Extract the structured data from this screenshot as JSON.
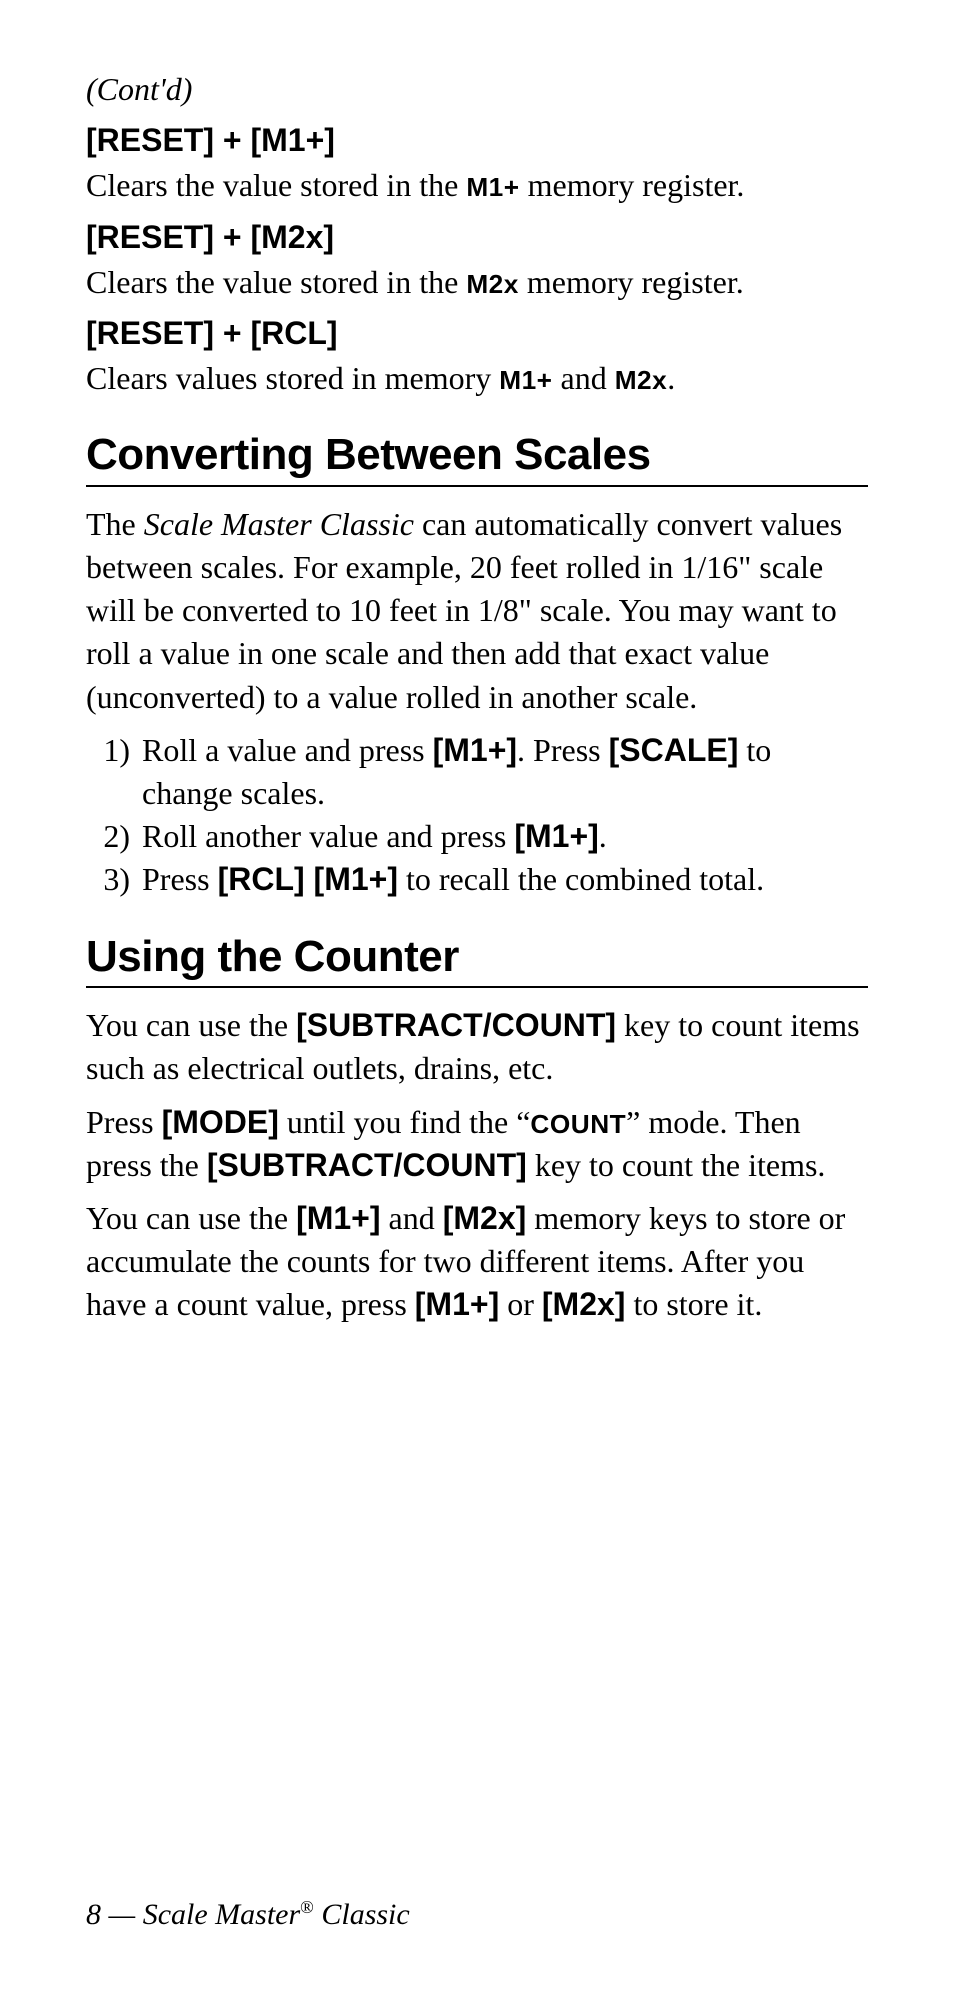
{
  "contd": "(Cont'd)",
  "reset_m1": {
    "label": "[RESET] + [M1+]",
    "desc_a": "Clears the value stored in the ",
    "mem": "M1+",
    "desc_b": " memory register."
  },
  "reset_m2": {
    "label": "[RESET] + [M2x]",
    "desc_a": "Clears the value stored in the ",
    "mem": "M2x",
    "desc_b": " memory register."
  },
  "reset_rcl": {
    "label": "[RESET] + [RCL]",
    "desc_a": "Clears values stored in memory ",
    "mem1": "M1+",
    "and": " and ",
    "mem2": "M2x",
    "period": "."
  },
  "section_convert": "Converting Between Scales",
  "convert_para": {
    "a": "The ",
    "product": "Scale Master Classic",
    "b": " can automatically convert values between scales. For example, 20 feet rolled in 1/16\" scale will be converted to 10 feet in 1/8\" scale. You may want to roll a value in one scale and then add that exact value (unconverted) to a value rolled in another scale."
  },
  "steps": {
    "s1": {
      "num": "1)",
      "a": "Roll a value and press ",
      "key1": "[M1+]",
      "b": ". Press ",
      "key2": "[SCALE]",
      "c": " to change scales."
    },
    "s2": {
      "num": "2)",
      "a": "Roll another value and press ",
      "key1": "[M1+]",
      "b": "."
    },
    "s3": {
      "num": "3)",
      "a": "Press ",
      "key1": "[RCL] [M1+]",
      "b": " to recall the combined total."
    }
  },
  "section_counter": "Using the Counter",
  "counter_p1": {
    "a": "You can use the ",
    "key": "[SUBTRACT/COUNT]",
    "b": " key to count items such as electrical outlets, drains, etc."
  },
  "counter_p2": {
    "a": "Press ",
    "key1": "[MODE]",
    "b": " until you find the “",
    "mode": "COUNT",
    "c": "” mode. Then press the ",
    "key2": "[SUBTRACT/COUNT]",
    "d": " key to count the items."
  },
  "counter_p3": {
    "a": "You can use the ",
    "key1": "[M1+]",
    "b": " and ",
    "key2": "[M2x]",
    "c": " memory keys to store or accumulate the counts for two different items. After you have a count value, press ",
    "key3": "[M1+]",
    "d": " or ",
    "key4": "[M2x]",
    "e": " to store it."
  },
  "footer": {
    "page": "8",
    "dash": " — ",
    "title_a": "Scale Master",
    "reg": "®",
    "title_b": " Classic"
  }
}
